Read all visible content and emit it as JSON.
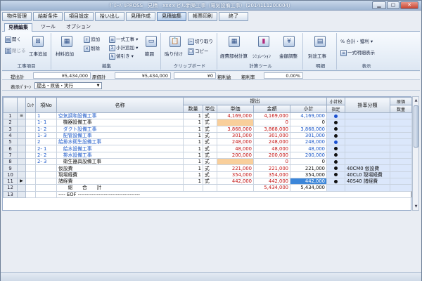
{
  "window": {
    "title": "ｸﾞﾛｰﾊﾞﾙPROSS　見積　xxxｘビル新築工事（電気設備工事）（2014111200004）",
    "min": "▁",
    "max": "▢",
    "close": "✕"
  },
  "menu": [
    {
      "label": "物件管理"
    },
    {
      "label": "給新条件"
    },
    {
      "label": "項目設定"
    },
    {
      "label": "拾い出し"
    },
    {
      "label": "見積作成"
    },
    {
      "label": "見積編集",
      "active": true
    },
    {
      "label": "帳票印刷"
    },
    {
      "label": "終了"
    }
  ],
  "tabs": [
    {
      "label": "見積編集",
      "active": true
    },
    {
      "label": "ツール"
    },
    {
      "label": "オプション"
    }
  ],
  "ribbon": {
    "g1": {
      "label": "工事項目",
      "b1": "開く",
      "b2": "閉じる",
      "b3": "工事追加"
    },
    "g2": {
      "label": "編集",
      "b1": "材料追加",
      "b2": "追加",
      "b3": "削除",
      "b4": "一式工事",
      "b5": "小計追加",
      "b6": "値引き",
      "b7": "範囲"
    },
    "g3": {
      "label": "クリップボード",
      "b1": "貼り付け",
      "b2": "切り取り",
      "b3": "コピー"
    },
    "g4": {
      "label": "計算ツール",
      "b1": "経費部材計算",
      "b2": "ｼﾐｭﾚｰｼｮﾝ",
      "b3": "金額調整"
    },
    "g5": {
      "label": "明細",
      "b1": "別途工事"
    },
    "g6": {
      "label": "表示",
      "b1": "合計・獲利",
      "b2": "一式明細表示"
    }
  },
  "summary": {
    "l1": "提出計",
    "v1": "¥5,434,000",
    "l2": "原価計",
    "v2": "¥5,434,000",
    "l3": "粗利益",
    "v3": "¥0",
    "l4": "粗利率",
    "v4": "0.00%"
  },
  "mode": {
    "label": "表示ﾊﾟﾀｰﾝ",
    "value": "提出・原価・実行"
  },
  "grid": {
    "h": {
      "lock": "ﾛｯｸ",
      "no": "項No",
      "name": "名称",
      "teishutsu": "提出",
      "qty": "数量",
      "unit": "単位",
      "price": "単価",
      "amount": "金額",
      "subtotal": "小計",
      "sub_flag1": "小計校",
      "sub_flag2": "指定",
      "rate": "掛率分類",
      "cost1": "原価",
      "cost2": "数量"
    },
    "rows": [
      {
        "rn": "1",
        "ind": "≡",
        "no": "1",
        "name": "空気調和設備工事",
        "qty": "1",
        "unit": "式",
        "price": "4,169,000",
        "amount": "4,169,000",
        "sub": "4,169,000",
        "dot": "blue",
        "rate": "",
        "style": "blue"
      },
      {
        "rn": "2",
        "ind": "",
        "no": "1- 1",
        "name": "　機器設備工事",
        "qty": "1",
        "unit": "式",
        "price": "",
        "amount": "0",
        "sub": "0",
        "dot": "black",
        "rate": "",
        "style": "black",
        "peach": true
      },
      {
        "rn": "3",
        "ind": "",
        "no": "1- 2",
        "name": "　ダクト設備工事",
        "qty": "1",
        "unit": "式",
        "price": "3,868,000",
        "amount": "3,868,000",
        "sub": "3,868,000",
        "dot": "black",
        "rate": "",
        "style": "blue"
      },
      {
        "rn": "4",
        "ind": "",
        "no": "1- 3",
        "name": "　配管設備工事",
        "qty": "1",
        "unit": "式",
        "price": "301,000",
        "amount": "301,000",
        "sub": "301,000",
        "dot": "black",
        "rate": "",
        "style": "blue"
      },
      {
        "rn": "5",
        "ind": "",
        "no": "2",
        "name": "給排水衛生設備工事",
        "qty": "1",
        "unit": "式",
        "price": "248,000",
        "amount": "248,000",
        "sub": "248,000",
        "dot": "blue",
        "rate": "",
        "style": "blue"
      },
      {
        "rn": "6",
        "ind": "",
        "no": "2- 1",
        "name": "　給水設備工事",
        "qty": "1",
        "unit": "式",
        "price": "48,000",
        "amount": "48,000",
        "sub": "48,000",
        "dot": "black",
        "rate": "",
        "style": "blue"
      },
      {
        "rn": "7",
        "ind": "",
        "no": "2- 2",
        "name": "　排水設備工事",
        "qty": "1",
        "unit": "式",
        "price": "200,000",
        "amount": "200,000",
        "sub": "200,000",
        "dot": "black",
        "rate": "",
        "style": "blue"
      },
      {
        "rn": "8",
        "ind": "",
        "no": "2- 3",
        "name": "　衛生器具設備工事",
        "qty": "1",
        "unit": "式",
        "price": "",
        "amount": "0",
        "sub": "0",
        "dot": "black",
        "rate": "",
        "style": "black",
        "peach": true
      },
      {
        "rn": "9",
        "ind": "",
        "no": "",
        "name": "仮設費",
        "qty": "1",
        "unit": "式",
        "price": "221,000",
        "amount": "221,000",
        "sub": "221,000",
        "dot": "black",
        "rate": "40CM0 仮設費",
        "style": "black"
      },
      {
        "rn": "10",
        "ind": "",
        "no": "",
        "name": "現場経費",
        "qty": "1",
        "unit": "式",
        "price": "354,000",
        "amount": "354,000",
        "sub": "354,000",
        "dot": "black",
        "rate": "40CL0 現場経費",
        "style": "black"
      },
      {
        "rn": "11",
        "ind": "▶",
        "no": "",
        "name": "諸経費",
        "qty": "1",
        "unit": "式",
        "price": "442,000",
        "amount": "442,000",
        "sub": "442,000",
        "dot": "black",
        "rate": "40S40 諸経費",
        "style": "black",
        "hl": true
      },
      {
        "rn": "12",
        "ind": "",
        "no": "",
        "name": "　　総　　合　　計",
        "qty": "",
        "unit": "",
        "price": "",
        "amount": "5,434,000",
        "sub": "5,434,000",
        "dot": "",
        "rate": "",
        "style": "black",
        "total": true
      },
      {
        "rn": "13",
        "ind": "",
        "no": "",
        "name": "---- EOF ------------------------------------",
        "qty": "",
        "unit": "",
        "price": "",
        "amount": "",
        "sub": "",
        "dot": "",
        "rate": "",
        "style": "eof"
      }
    ]
  },
  "colors": {
    "blue": "#1a57c9",
    "red": "#c31414",
    "peach": "#f9cf9b",
    "highlight": "#3c86d9"
  }
}
